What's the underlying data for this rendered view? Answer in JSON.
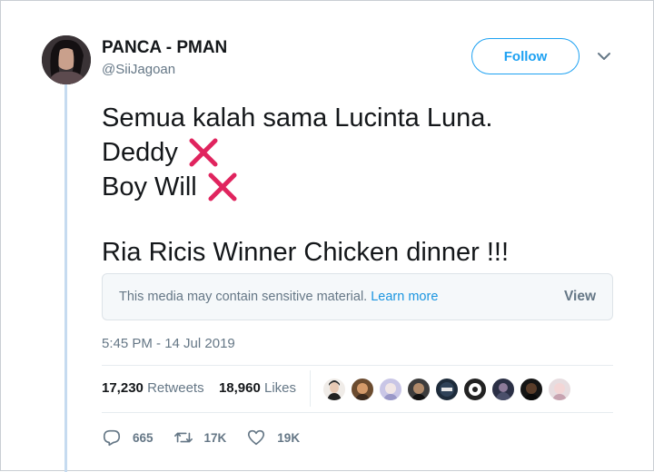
{
  "tweet": {
    "author_name": "PANCA - PMAN",
    "author_handle": "@SiiJagoan",
    "follow_label": "Follow",
    "line1": "Semua kalah sama Lucinta Luna.",
    "line2": "Deddy",
    "line3": "Boy Will",
    "line4": "Ria Ricis Winner Chicken dinner !!!",
    "timestamp": "5:45 PM - 14 Jul 2019"
  },
  "sensitive_media": {
    "message": "This media may contain sensitive material.",
    "learn_more": "Learn more",
    "view_label": "View"
  },
  "stats": {
    "retweets_count": "17,230",
    "retweets_label": "Retweets",
    "likes_count": "18,960",
    "likes_label": "Likes"
  },
  "actions": {
    "replies": "665",
    "retweets": "17K",
    "likes": "19K"
  },
  "icons": [
    "chevron-down-icon",
    "cross-mark-icon",
    "reply-icon",
    "retweet-icon",
    "heart-icon"
  ],
  "colors": {
    "accent": "#1da1f2",
    "cross_mark": "#e0245e",
    "secondary_text": "#657786"
  }
}
